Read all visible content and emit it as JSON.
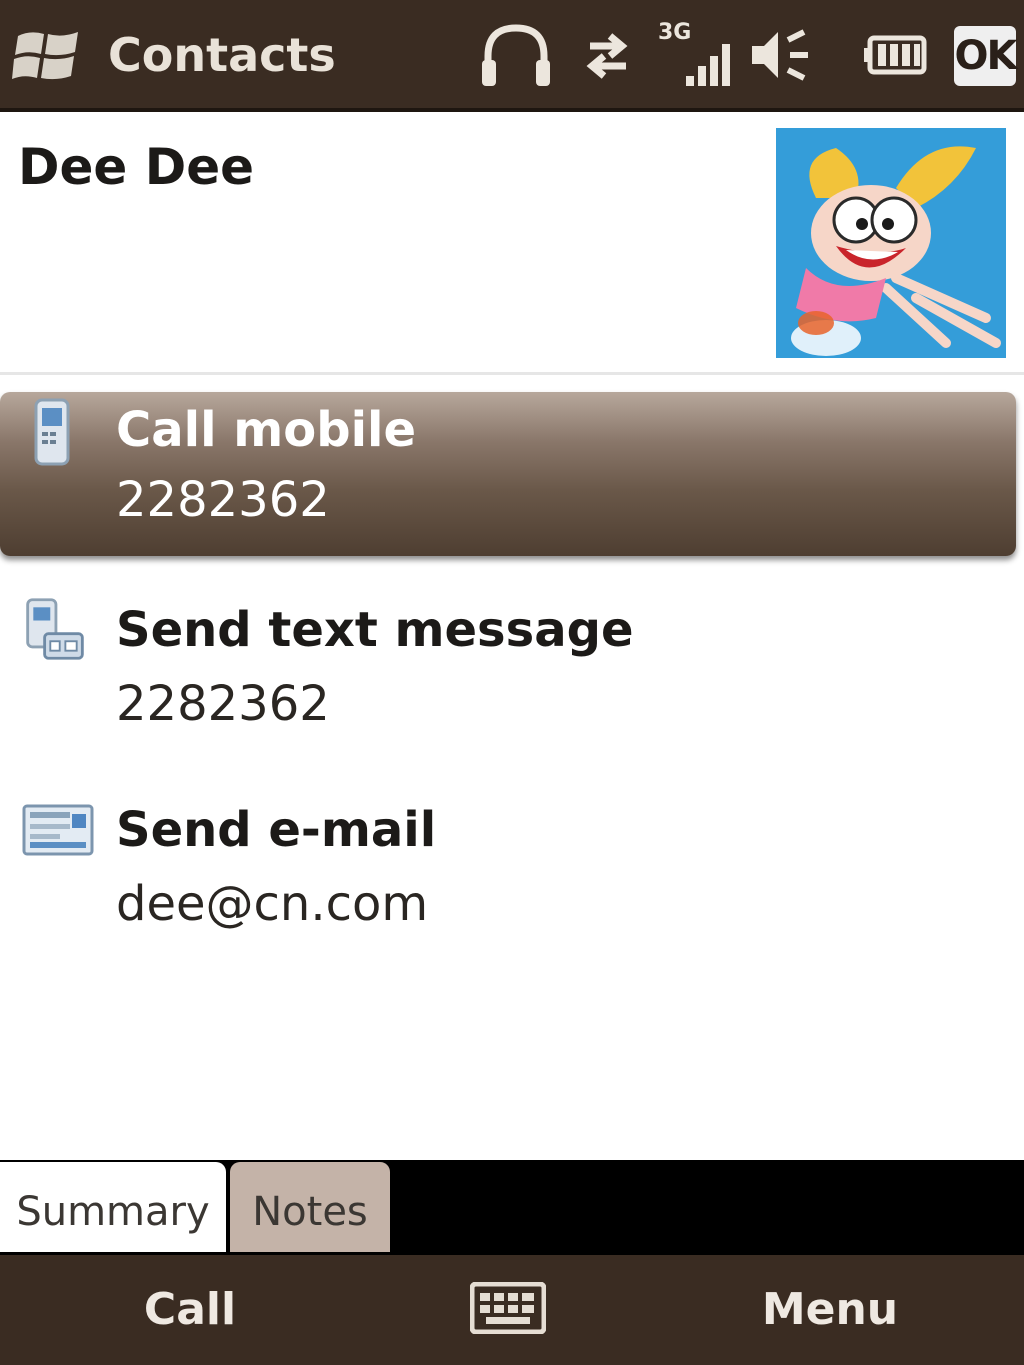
{
  "title_bar": {
    "title": "Contacts",
    "network_label": "3G",
    "ok_label": "OK",
    "icons": [
      "windows-start-icon",
      "headphones-icon",
      "data-connection-icon",
      "signal-icon",
      "speaker-icon",
      "battery-icon"
    ]
  },
  "contact": {
    "name": "Dee Dee",
    "photo": "contact-photo"
  },
  "actions": [
    {
      "label": "Call mobile",
      "value": "2282362",
      "icon": "mobile-phone-icon",
      "selected": true
    },
    {
      "label": "Send text message",
      "value": "2282362",
      "icon": "text-message-icon",
      "selected": false
    },
    {
      "label": "Send e-mail",
      "value": "dee@cn.com",
      "icon": "email-icon",
      "selected": false
    }
  ],
  "tabs": [
    {
      "label": "Summary",
      "active": true
    },
    {
      "label": "Notes",
      "active": false
    }
  ],
  "menu_bar": {
    "left_label": "Call",
    "center_icon": "keyboard-icon",
    "right_label": "Menu"
  },
  "colors": {
    "bar_background": "#3a2c22",
    "selected_top": "#b7a89c",
    "selected_bottom": "#4e3e31",
    "notes_tab": "#c4b3a8"
  }
}
